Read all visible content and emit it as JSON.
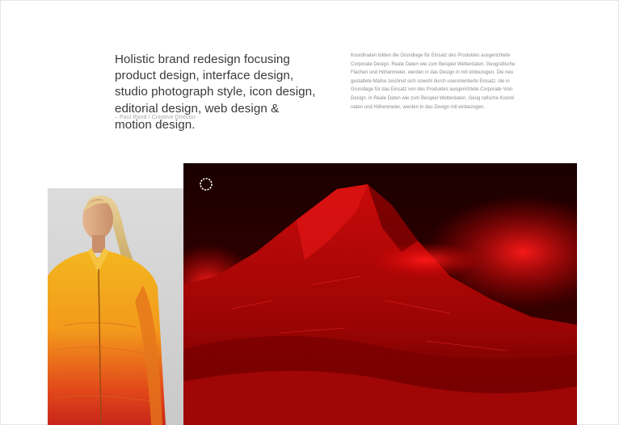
{
  "intro": {
    "headline": "Holistic brand redesign focusing product design, interface design, studio photograph style, icon design, editorial design, web design & motion design.",
    "attribution": "– Paul Rand / Creative Director",
    "body": "Koordinaten bilden die Grundlage für Einsatz des Produktes ausgerichtete Corporate Design. Reale Daten wie zum Beispiel Wetterdaten, Geografische Flächen und Höhenmeter, werden in das Design in mit einbezogen. Die neu gestaltete Marke zeichnet sich sowohl durch userorientierte Einsatz. die in Grundlage für das Einsatz von des Produktes ausgerichtete Corporate Voin Design. in Reale Daten wie zum Beispiel Wetterdaten, Geog rafische Koordi naten und Höhenmeter, werden in das Design mit einbezogen."
  },
  "gallery": {
    "portrait_icon": "woman-orange-jacket-photo",
    "mountain_icon": "red-mountain-photo",
    "loader_icon": "loading-ring-icon"
  },
  "colors": {
    "accent_red": "#d10000",
    "jacket_orange": "#f0a020",
    "text_dark": "#3a3a3a",
    "text_muted": "#8b8b8b"
  }
}
